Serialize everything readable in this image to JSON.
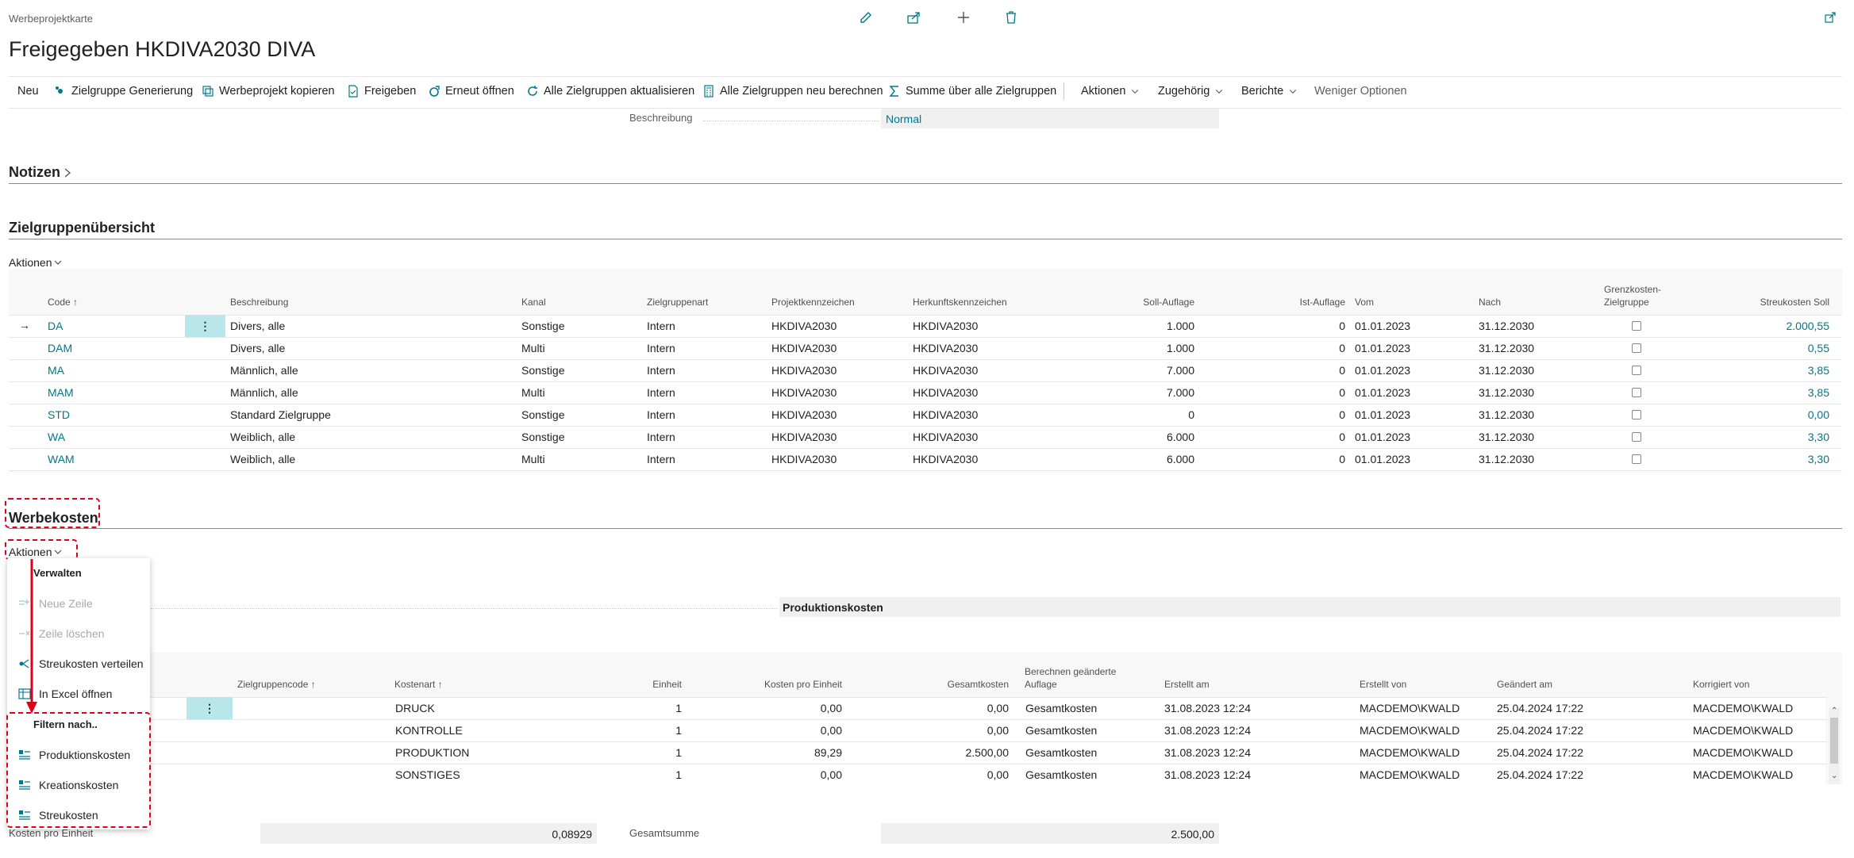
{
  "header": {
    "breadcrumb": "Werbeprojektkarte",
    "title": "Freigegeben HKDIVA2030 DIVA"
  },
  "toolbar": {
    "new": "Neu",
    "zielgruppe_gen": "Zielgruppe Generierung",
    "copy": "Werbeprojekt kopieren",
    "release": "Freigeben",
    "reopen": "Erneut öffnen",
    "update_all": "Alle Zielgruppen aktualisieren",
    "recalc_all": "Alle Zielgruppen neu berechnen",
    "sum_all": "Summe über alle Zielgruppen",
    "actions": "Aktionen",
    "related": "Zugehörig",
    "reports": "Berichte",
    "fewer": "Weniger Optionen"
  },
  "general": {
    "beschreibung_label": "Beschreibung",
    "beschreibung_value": "Normal"
  },
  "notes": {
    "title": "Notizen"
  },
  "zielgruppen": {
    "title": "Zielgruppenübersicht",
    "actions": "Aktionen",
    "headers": {
      "code": "Code",
      "beschreibung": "Beschreibung",
      "kanal": "Kanal",
      "art": "Zielgruppenart",
      "projekt": "Projektkennzeichen",
      "herkunft": "Herkunftskennzeichen",
      "soll": "Soll-Auflage",
      "ist": "Ist-Auflage",
      "vom": "Vom",
      "nach": "Nach",
      "grenz1": "Grenzkosten-",
      "grenz2": "Zielgruppe",
      "streu": "Streukosten Soll"
    },
    "rows": [
      {
        "code": "DA",
        "beschreibung": "Divers, alle",
        "kanal": "Sonstige",
        "art": "Intern",
        "projekt": "HKDIVA2030",
        "herkunft": "HKDIVA2030",
        "soll": "1.000",
        "ist": "0",
        "vom": "01.01.2023",
        "nach": "31.12.2030",
        "streu": "2.000,55"
      },
      {
        "code": "DAM",
        "beschreibung": "Divers, alle",
        "kanal": "Multi",
        "art": "Intern",
        "projekt": "HKDIVA2030",
        "herkunft": "HKDIVA2030",
        "soll": "1.000",
        "ist": "0",
        "vom": "01.01.2023",
        "nach": "31.12.2030",
        "streu": "0,55"
      },
      {
        "code": "MA",
        "beschreibung": "Männlich, alle",
        "kanal": "Sonstige",
        "art": "Intern",
        "projekt": "HKDIVA2030",
        "herkunft": "HKDIVA2030",
        "soll": "7.000",
        "ist": "0",
        "vom": "01.01.2023",
        "nach": "31.12.2030",
        "streu": "3,85"
      },
      {
        "code": "MAM",
        "beschreibung": "Männlich, alle",
        "kanal": "Multi",
        "art": "Intern",
        "projekt": "HKDIVA2030",
        "herkunft": "HKDIVA2030",
        "soll": "7.000",
        "ist": "0",
        "vom": "01.01.2023",
        "nach": "31.12.2030",
        "streu": "3,85"
      },
      {
        "code": "STD",
        "beschreibung": "Standard Zielgruppe",
        "kanal": "Sonstige",
        "art": "Intern",
        "projekt": "HKDIVA2030",
        "herkunft": "HKDIVA2030",
        "soll": "0",
        "ist": "0",
        "vom": "01.01.2023",
        "nach": "31.12.2030",
        "streu": "0,00"
      },
      {
        "code": "WA",
        "beschreibung": "Weiblich, alle",
        "kanal": "Sonstige",
        "art": "Intern",
        "projekt": "HKDIVA2030",
        "herkunft": "HKDIVA2030",
        "soll": "6.000",
        "ist": "0",
        "vom": "01.01.2023",
        "nach": "31.12.2030",
        "streu": "3,30"
      },
      {
        "code": "WAM",
        "beschreibung": "Weiblich, alle",
        "kanal": "Multi",
        "art": "Intern",
        "projekt": "HKDIVA2030",
        "herkunft": "HKDIVA2030",
        "soll": "6.000",
        "ist": "0",
        "vom": "01.01.2023",
        "nach": "31.12.2030",
        "streu": "3,30"
      }
    ]
  },
  "werbekosten": {
    "title": "Werbekosten",
    "actions": "Aktionen",
    "filter_value": "Produktionskosten",
    "headers": {
      "zgcode": "Zielgruppencode",
      "kostenart": "Kostenart",
      "einheit": "Einheit",
      "kpe": "Kosten pro Einheit",
      "gesamt": "Gesamtkosten",
      "ber1": "Berechnen geänderte",
      "ber2": "Auflage",
      "erstellt_am": "Erstellt am",
      "erstellt_von": "Erstellt von",
      "geaendert_am": "Geändert am",
      "korrigiert_von": "Korrigiert von"
    },
    "rows": [
      {
        "kostenart": "DRUCK",
        "einheit": "1",
        "kpe": "0,00",
        "gesamt": "0,00",
        "ber": "Gesamtkosten",
        "erstellt_am": "31.08.2023 12:24",
        "erstellt_von": "MACDEMO\\KWALD",
        "geaendert_am": "25.04.2024 17:22",
        "korrigiert_von": "MACDEMO\\KWALD"
      },
      {
        "kostenart": "KONTROLLE",
        "einheit": "1",
        "kpe": "0,00",
        "gesamt": "0,00",
        "ber": "Gesamtkosten",
        "erstellt_am": "31.08.2023 12:24",
        "erstellt_von": "MACDEMO\\KWALD",
        "geaendert_am": "25.04.2024 17:22",
        "korrigiert_von": "MACDEMO\\KWALD"
      },
      {
        "kostenart": "PRODUKTION",
        "einheit": "1",
        "kpe": "89,29",
        "gesamt": "2.500,00",
        "ber": "Gesamtkosten",
        "erstellt_am": "31.08.2023 12:24",
        "erstellt_von": "MACDEMO\\KWALD",
        "geaendert_am": "25.04.2024 17:22",
        "korrigiert_von": "MACDEMO\\KWALD"
      },
      {
        "kostenart": "SONSTIGES",
        "einheit": "1",
        "kpe": "0,00",
        "gesamt": "0,00",
        "ber": "Gesamtkosten",
        "erstellt_am": "31.08.2023 12:24",
        "erstellt_von": "MACDEMO\\KWALD",
        "geaendert_am": "25.04.2024 17:22",
        "korrigiert_von": "MACDEMO\\KWALD"
      }
    ],
    "footer": {
      "kpe_label": "Kosten pro Einheit",
      "kpe_value": "0,08929",
      "sum_label": "Gesamtsumme",
      "sum_value": "2.500,00"
    }
  },
  "menu": {
    "group1": "Verwalten",
    "new_line": "Neue Zeile",
    "delete_line": "Zeile löschen",
    "distribute": "Streukosten verteilen",
    "excel": "In Excel öffnen",
    "group2": "Filtern nach..",
    "filter_prod": "Produktionskosten",
    "filter_krea": "Kreationskosten",
    "filter_streu": "Streukosten"
  },
  "colors": {
    "accent": "#00778a",
    "highlight": "#e0001a",
    "selected_cell": "#b8e6ea"
  }
}
